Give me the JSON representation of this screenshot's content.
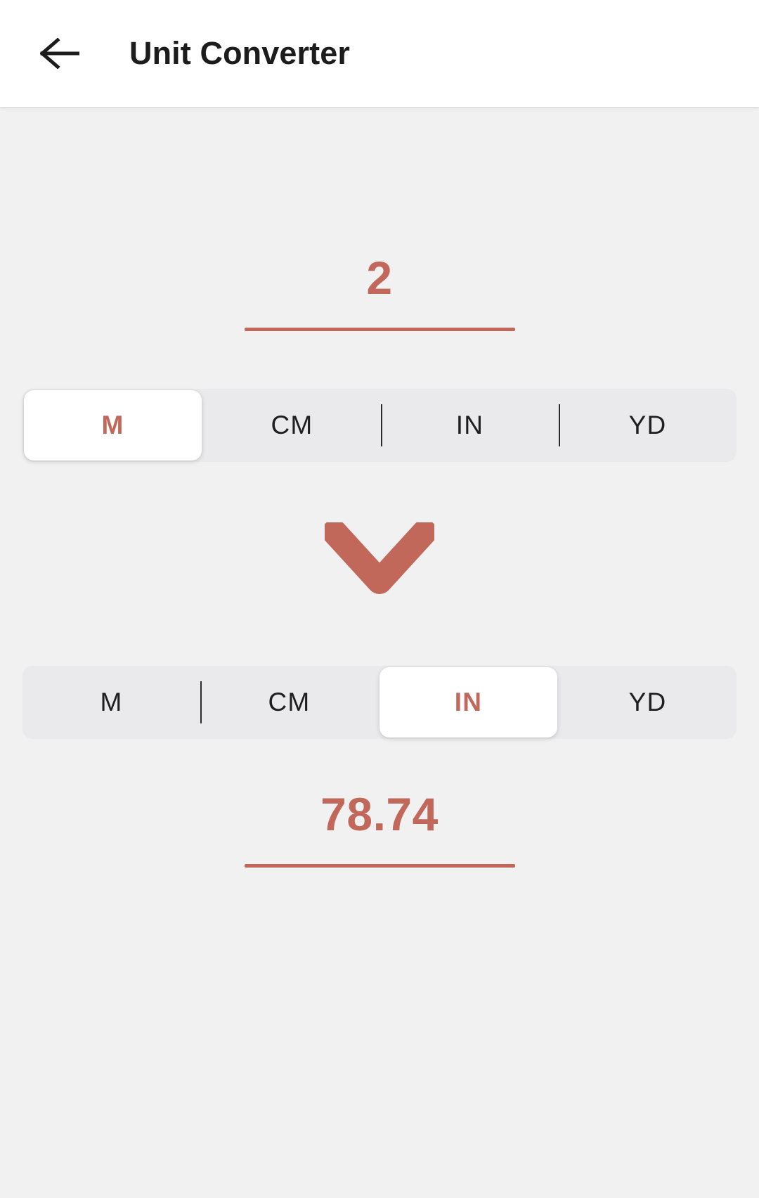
{
  "app": {
    "title": "Unit Converter",
    "accent_color": "#C1685B",
    "background_color": "#F1F1F1",
    "appbar_color": "#FFFFFF",
    "track_color": "#EAEAEC"
  },
  "header": {
    "back_icon": "arrow-left-icon",
    "title": "Unit Converter"
  },
  "converter": {
    "input": {
      "value": "2",
      "placeholder": "0",
      "unit_selected": "M"
    },
    "direction_icon": "chevron-down-icon",
    "output": {
      "value": "78.74",
      "placeholder": "0",
      "unit_selected": "IN"
    },
    "from_units": [
      {
        "label": "M",
        "selected": true
      },
      {
        "label": "CM",
        "selected": false
      },
      {
        "label": "IN",
        "selected": false
      },
      {
        "label": "YD",
        "selected": false
      }
    ],
    "to_units": [
      {
        "label": "M",
        "selected": false
      },
      {
        "label": "CM",
        "selected": false
      },
      {
        "label": "IN",
        "selected": true
      },
      {
        "label": "YD",
        "selected": false
      }
    ]
  }
}
